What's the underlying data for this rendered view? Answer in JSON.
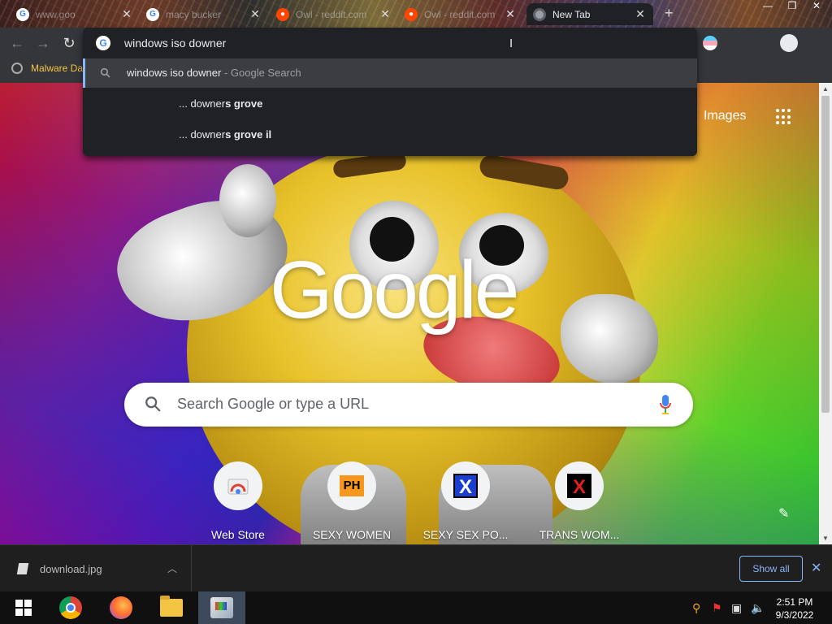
{
  "tabs": [
    {
      "title": "www.goo",
      "favicon": "google-favicon",
      "active": false
    },
    {
      "title": "macy bucker",
      "favicon": "google-favicon",
      "active": false
    },
    {
      "title": "Owl - reddit.com",
      "favicon": "reddit-favicon",
      "active": false
    },
    {
      "title": "Owl - reddit.com",
      "favicon": "reddit-favicon",
      "active": false
    },
    {
      "title": "New Tab",
      "favicon": "chrome-favicon",
      "active": true
    }
  ],
  "omnibox": {
    "input": "windows iso downer",
    "suggestions": [
      {
        "text": "windows iso downer",
        "suffix": " - Google Search",
        "selected": true
      },
      {
        "prefix": "... downer",
        "bold": "s grove",
        "selected": false
      },
      {
        "prefix": "... downer",
        "bold": "s grove il",
        "selected": false
      }
    ]
  },
  "bookmarks": [
    {
      "label": "Malware Da"
    }
  ],
  "page": {
    "images_link": "Images",
    "logo_text": "Google",
    "search_placeholder": "Search Google or type a URL",
    "shortcuts": [
      {
        "label": "Web Store",
        "icon": "chrome-web-store-icon"
      },
      {
        "label": "SEXY WOMEN",
        "icon": "ph-icon",
        "icon_text": "PH"
      },
      {
        "label": "SEXY SEX PO...",
        "icon": "x-icon",
        "icon_text": "X"
      },
      {
        "label": "TRANS WOM...",
        "icon": "x-dark-icon",
        "icon_text": "X"
      }
    ]
  },
  "download_bar": {
    "filename": "download.jpg",
    "show_all": "Show all"
  },
  "taskbar": {
    "time": "2:51 PM",
    "date": "9/3/2022"
  },
  "colors": {
    "toolbar": "#35363a",
    "omnibox_bg": "#202124",
    "accent_blue": "#8ab4f8"
  }
}
